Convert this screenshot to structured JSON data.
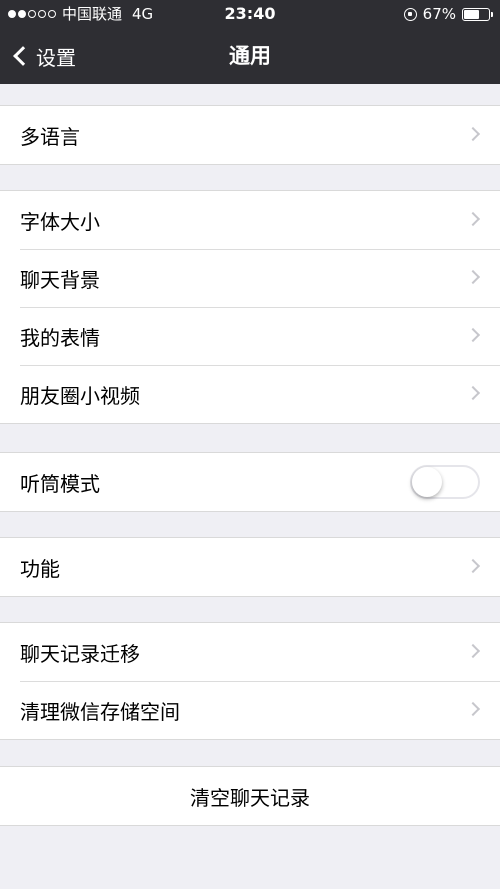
{
  "status_bar": {
    "carrier": "中国联通",
    "network": "4G",
    "time": "23:40",
    "battery": "67%",
    "battery_level": 0.67,
    "signal_bars_filled": 2,
    "signal_bars_total": 5
  },
  "nav": {
    "back_label": "设置",
    "title": "通用"
  },
  "groups": {
    "language": {
      "items": [
        {
          "label": "多语言"
        }
      ]
    },
    "display": {
      "items": [
        {
          "label": "字体大小"
        },
        {
          "label": "聊天背景"
        },
        {
          "label": "我的表情"
        },
        {
          "label": "朋友圈小视频"
        }
      ]
    },
    "earpiece": {
      "label": "听筒模式",
      "toggle_on": false
    },
    "features": {
      "items": [
        {
          "label": "功能"
        }
      ]
    },
    "storage": {
      "items": [
        {
          "label": "聊天记录迁移"
        },
        {
          "label": "清理微信存储空间"
        }
      ]
    },
    "clear": {
      "label": "清空聊天记录"
    }
  },
  "colors": {
    "bar_background": "#2e2e33",
    "page_background": "#efeff4",
    "chevron": "#c7c7cc"
  }
}
